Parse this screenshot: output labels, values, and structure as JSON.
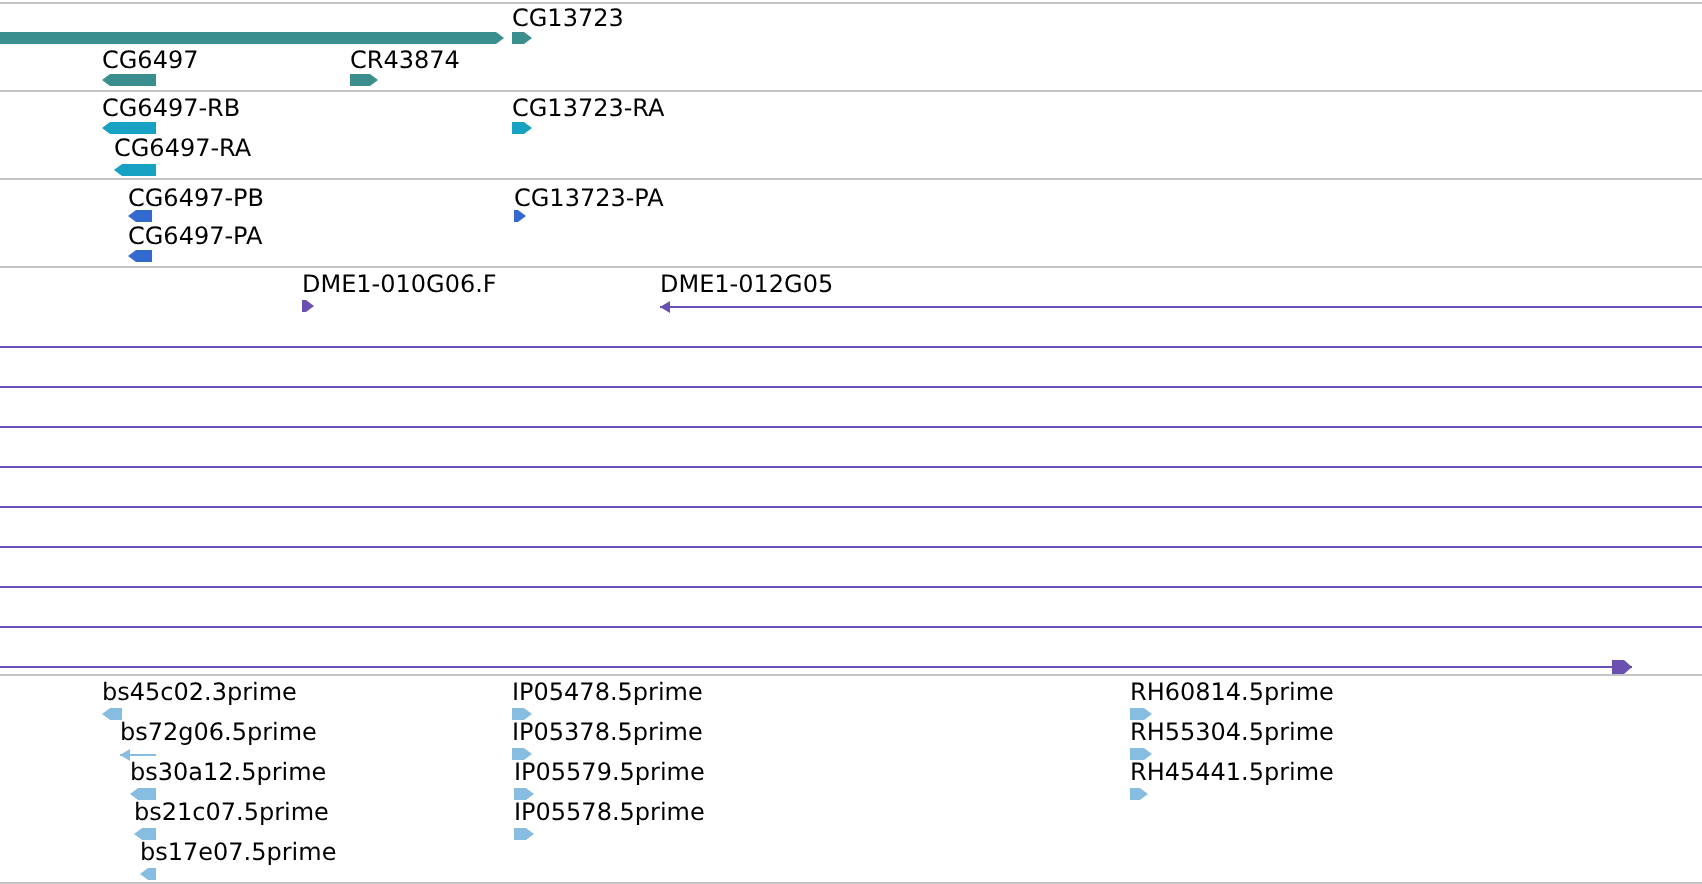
{
  "tracks": [
    {
      "color": "#3a8e8e",
      "features": [
        {
          "kind": "bar",
          "pointed": true,
          "forward": true
        },
        {
          "kind": "bar",
          "pointed": true,
          "forward": true,
          "label": "CG13723"
        },
        {
          "kind": "bar",
          "pointed": true,
          "forward": false,
          "label": "CG6497"
        },
        {
          "kind": "bar",
          "pointed": true,
          "forward": true,
          "label": "CR43874"
        }
      ]
    },
    {
      "color": "#17a2c4",
      "features": [
        {
          "kind": "bar",
          "pointed": true,
          "forward": false,
          "label": "CG6497-RB"
        },
        {
          "kind": "bar",
          "pointed": true,
          "forward": false,
          "label": "CG6497-RA"
        },
        {
          "kind": "bar",
          "pointed": true,
          "forward": true,
          "label": "CG13723-RA"
        }
      ]
    },
    {
      "color": "#3369d1",
      "features": [
        {
          "kind": "bar",
          "pointed": true,
          "forward": false,
          "label": "CG6497-PB"
        },
        {
          "kind": "bar",
          "pointed": true,
          "forward": false,
          "label": "CG6497-PA"
        },
        {
          "kind": "bar",
          "pointed": true,
          "forward": true,
          "label": "CG13723-PA"
        }
      ]
    },
    {
      "color": "#6a50b0",
      "features": [
        {
          "kind": "bar",
          "pointed": true,
          "forward": true,
          "label": "DME1-010G06.F"
        },
        {
          "kind": "line",
          "pointed": true,
          "forward": false,
          "label": "DME1-012G05"
        },
        {
          "kind": "line",
          "pointed": false
        },
        {
          "kind": "line",
          "pointed": false
        },
        {
          "kind": "line",
          "pointed": false
        },
        {
          "kind": "line",
          "pointed": false
        },
        {
          "kind": "line",
          "pointed": false
        },
        {
          "kind": "line",
          "pointed": false
        },
        {
          "kind": "line",
          "pointed": false
        },
        {
          "kind": "line",
          "pointed": false
        },
        {
          "kind": "line",
          "pointed": true,
          "forward": true
        }
      ]
    },
    {
      "color": "#88bde2",
      "features": [
        {
          "kind": "bar",
          "pointed": true,
          "forward": false,
          "label": "bs45c02.3prime"
        },
        {
          "kind": "line",
          "pointed": true,
          "forward": false,
          "label": "bs72g06.5prime"
        },
        {
          "kind": "bar",
          "pointed": true,
          "forward": false,
          "label": "bs30a12.5prime"
        },
        {
          "kind": "bar",
          "pointed": true,
          "forward": false,
          "label": "bs21c07.5prime"
        },
        {
          "kind": "bar",
          "pointed": true,
          "forward": false,
          "label": "bs17e07.5prime"
        },
        {
          "kind": "bar",
          "pointed": true,
          "forward": true,
          "label": "IP05478.5prime"
        },
        {
          "kind": "bar",
          "pointed": true,
          "forward": true,
          "label": "IP05378.5prime"
        },
        {
          "kind": "bar",
          "pointed": true,
          "forward": true,
          "label": "IP05579.5prime"
        },
        {
          "kind": "bar",
          "pointed": true,
          "forward": true,
          "label": "IP05578.5prime"
        },
        {
          "kind": "bar",
          "pointed": true,
          "forward": true,
          "label": "RH60814.5prime"
        },
        {
          "kind": "bar",
          "pointed": true,
          "forward": true,
          "label": "RH55304.5prime"
        },
        {
          "kind": "bar",
          "pointed": true,
          "forward": true,
          "label": "RH45441.5prime"
        }
      ]
    }
  ]
}
